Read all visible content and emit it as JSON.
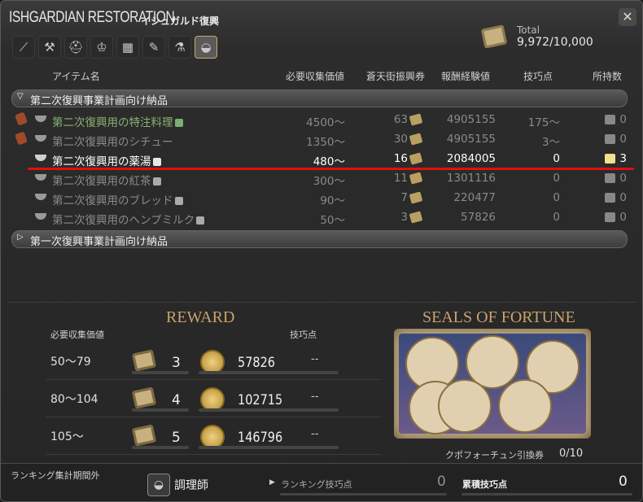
{
  "window": {
    "title": "ISHGARDIAN RESTORATION",
    "title_jp": "イシュガルド復興",
    "close_icon": "✕"
  },
  "tabs": [
    {
      "icon": "carpenter-icon",
      "glyph": "⟋"
    },
    {
      "icon": "blacksmith-icon",
      "glyph": "⚒"
    },
    {
      "icon": "armorer-icon",
      "glyph": "⛑"
    },
    {
      "icon": "goldsmith-icon",
      "glyph": "♔"
    },
    {
      "icon": "leatherworker-icon",
      "glyph": "▦"
    },
    {
      "icon": "weaver-icon",
      "glyph": "✎"
    },
    {
      "icon": "alchemist-icon",
      "glyph": "⚗"
    },
    {
      "icon": "culinarian-icon",
      "glyph": "◒"
    }
  ],
  "total": {
    "label": "Total",
    "value": "9,972/10,000"
  },
  "columns": {
    "item": "アイテム名",
    "collect": "必要収集価値",
    "scrip": "蒼天街振興券",
    "exp": "報酬経験値",
    "craft": "技巧点",
    "owned": "所持数"
  },
  "groups": [
    {
      "label": "第二次復興事業計画向け納品",
      "arrow": "▽"
    },
    {
      "label": "第一次復興事業計画向け納品",
      "arrow": "▷"
    }
  ],
  "rows": [
    {
      "name": "第二次復興用の特注料理",
      "collect": "4500〜",
      "scrip": "63",
      "exp": "4905155",
      "craft": "175〜",
      "owned": "0"
    },
    {
      "name": "第二次復興用のシチュー",
      "collect": "1350〜",
      "scrip": "30",
      "exp": "4905155",
      "craft": "3〜",
      "owned": "0"
    },
    {
      "name": "第二次復興用の薬湯",
      "collect": "480〜",
      "scrip": "16",
      "exp": "2084005",
      "craft": "0",
      "owned": "3"
    },
    {
      "name": "第二次復興用の紅茶",
      "collect": "300〜",
      "scrip": "11",
      "exp": "1301116",
      "craft": "0",
      "owned": "0"
    },
    {
      "name": "第二次復興用のブレッド",
      "collect": "90〜",
      "scrip": "7",
      "exp": "220477",
      "craft": "0",
      "owned": "0"
    },
    {
      "name": "第二次復興用のヘンプミルク",
      "collect": "50〜",
      "scrip": "3",
      "exp": "57826",
      "craft": "0",
      "owned": "0"
    }
  ],
  "reward": {
    "title": "REWARD",
    "hdr_collect": "必要収集価値",
    "hdr_craft": "技巧点",
    "rows": [
      {
        "range": "50〜79",
        "scrip": "3",
        "exp": "57826",
        "craft": "--"
      },
      {
        "range": "80〜104",
        "scrip": "4",
        "exp": "102715",
        "craft": "--"
      },
      {
        "range": "105〜",
        "scrip": "5",
        "exp": "146796",
        "craft": "--"
      }
    ]
  },
  "seals": {
    "title": "SEALS OF FORTUNE",
    "ticket_label": "クポフォーチュン引換券",
    "ticket_count": "0/10"
  },
  "footer": {
    "ranking_period": "ランキング集計期間外",
    "job": "調理師",
    "ranking_label": "ランキング技巧点",
    "ranking_value": "0",
    "total_label": "累積技巧点",
    "total_value": "0"
  }
}
